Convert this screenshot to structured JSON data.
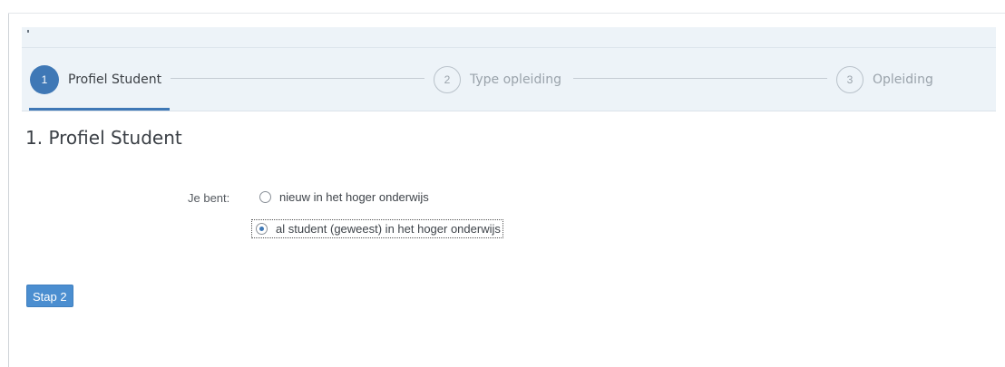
{
  "stepper": {
    "steps": [
      {
        "number": "1",
        "label": "Profiel Student",
        "state": "active"
      },
      {
        "number": "2",
        "label": "Type opleiding",
        "state": "inactive"
      },
      {
        "number": "3",
        "label": "Opleiding",
        "state": "inactive"
      }
    ]
  },
  "page": {
    "title": "1. Profiel Student"
  },
  "form": {
    "label": "Je bent:",
    "options": [
      {
        "label": "nieuw in het hoger onderwijs",
        "selected": false
      },
      {
        "label": "al student (geweest) in het hoger onderwijs",
        "selected": true
      }
    ]
  },
  "actions": {
    "next_label": "Stap 2"
  },
  "colors": {
    "accent": "#3f78b6",
    "button": "#4b8ed0",
    "stepper_background": "#edf3f8"
  },
  "icons": {
    "radio_unchecked": "radio-unchecked-icon",
    "radio_checked": "radio-checked-icon"
  }
}
